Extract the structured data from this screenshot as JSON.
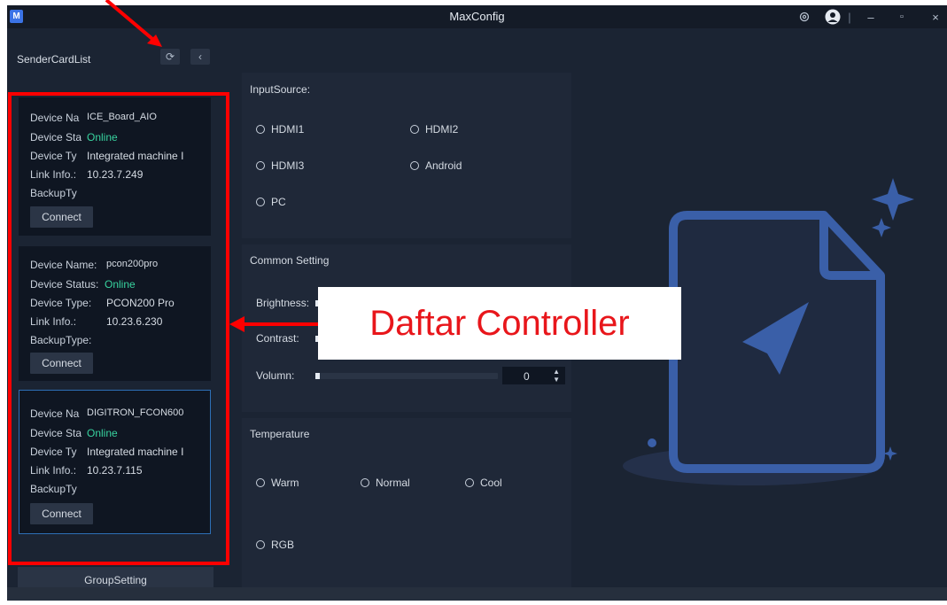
{
  "window": {
    "title": "MaxConfig",
    "logo_letter": "M",
    "controls": {
      "minimize": "–",
      "maximize": "▫",
      "close": "×"
    }
  },
  "sidebar": {
    "title": "SenderCardList",
    "refresh_icon": "refresh-icon",
    "collapse_icon": "chevron-left-icon",
    "cards": [
      {
        "name_label": "Device Na",
        "name": "ICE_Board_AIO",
        "status_label": "Device Sta",
        "status": "Online",
        "type_label": "Device Ty",
        "type": "Integrated machine I",
        "link_label": "Link Info.:",
        "link": "10.23.7.249",
        "backup_label": "BackupTy",
        "connect": "Connect"
      },
      {
        "name_label": "Device Name:",
        "name": "pcon200pro",
        "status_label": "Device Status:",
        "status": "Online",
        "type_label": "Device Type:",
        "type": "PCON200 Pro",
        "link_label": "Link Info.:",
        "link": "10.23.6.230",
        "backup_label": "BackupType:",
        "connect": "Connect"
      },
      {
        "name_label": "Device Na",
        "name": "DIGITRON_FCON600",
        "status_label": "Device Sta",
        "status": "Online",
        "type_label": "Device Ty",
        "type": "Integrated machine I",
        "link_label": "Link Info.:",
        "link": "10.23.7.115",
        "backup_label": "BackupTy",
        "connect": "Connect"
      }
    ],
    "group_setting": "GroupSetting"
  },
  "input_source": {
    "title": "InputSource:",
    "options": [
      "HDMI1",
      "HDMI2",
      "HDMI3",
      "Android",
      "PC"
    ]
  },
  "common_setting": {
    "title": "Common Setting",
    "brightness_label": "Brightness:",
    "contrast_label": "Contrast:",
    "volume_label": "Volumn:",
    "volume_value": "0"
  },
  "temperature": {
    "title": "Temperature",
    "options": [
      "Warm",
      "Normal",
      "Cool",
      "RGB"
    ]
  },
  "annotation": {
    "label": "Daftar Controller",
    "color": "#ff0000"
  },
  "colors": {
    "accent": "#3b73e6",
    "online": "#38d39f",
    "selected_border": "#2d6fb6",
    "illustration": "#3a5fa8"
  }
}
